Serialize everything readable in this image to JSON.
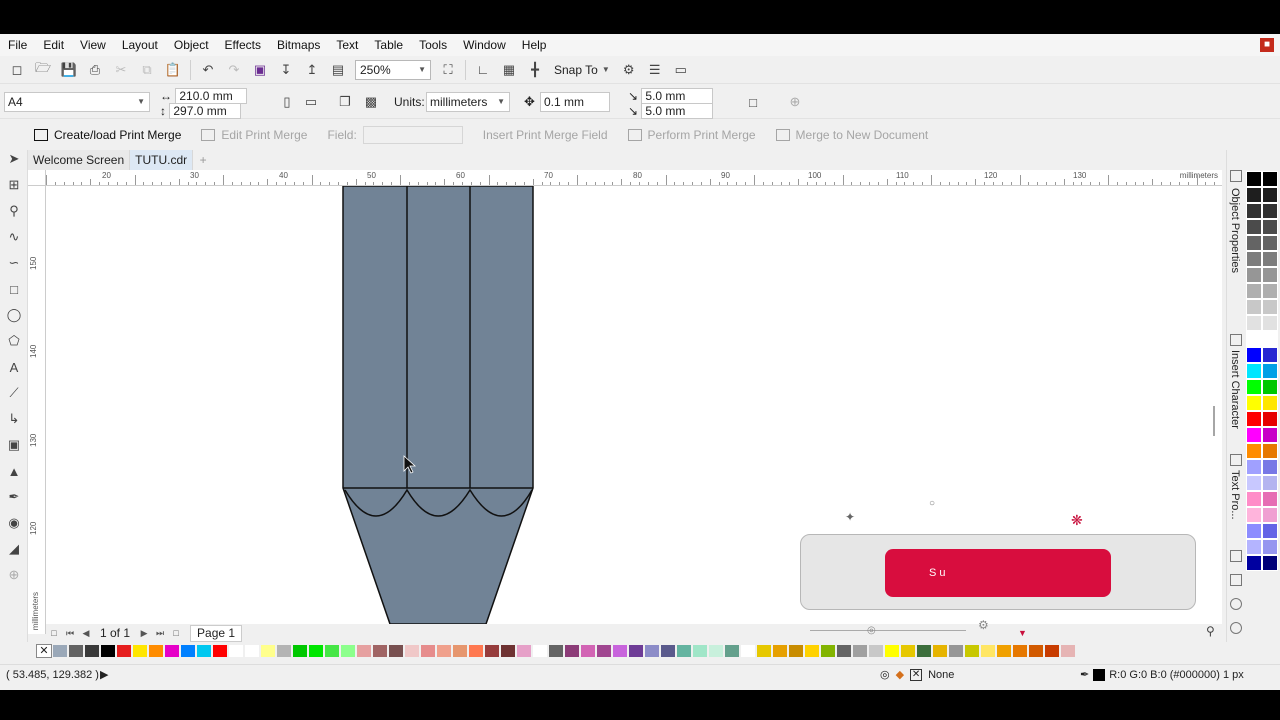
{
  "menu": {
    "items": [
      "File",
      "Edit",
      "View",
      "Layout",
      "Object",
      "Effects",
      "Bitmaps",
      "Text",
      "Table",
      "Tools",
      "Window",
      "Help"
    ]
  },
  "toolbar": {
    "zoom": "250%",
    "snap_to": "Snap To"
  },
  "property_bar": {
    "page_size": "A4",
    "width": "210.0 mm",
    "height": "297.0 mm",
    "units_label": "Units:",
    "units_value": "millimeters",
    "nudge": "0.1 mm",
    "dup_x": "5.0 mm",
    "dup_y": "5.0 mm"
  },
  "print_merge": {
    "create": "Create/load Print Merge",
    "edit": "Edit Print Merge",
    "field": "Field:",
    "insert": "Insert Print Merge Field",
    "perform": "Perform Print Merge",
    "merge_new": "Merge to New Document"
  },
  "tabs": [
    "Welcome Screen",
    "TUTU.cdr"
  ],
  "ruler": {
    "unit": "millimeters",
    "top_labels": [
      "20",
      "30",
      "40",
      "50",
      "60",
      "70",
      "80",
      "90",
      "100",
      "110",
      "120",
      "130"
    ],
    "left_labels": [
      "150",
      "140",
      "130",
      "120"
    ]
  },
  "pagenav": {
    "page_count": "1 of 1",
    "page_tab": "Page 1"
  },
  "dockers": [
    "Object Properties",
    "Insert Character",
    "Text Pro..."
  ],
  "status": {
    "coords": "( 53.485, 129.382 )",
    "fill_label": "None",
    "outline_info": "R:0 G:0 B:0 (#000000)  1 px"
  },
  "widget": {
    "button_text": "S  u"
  },
  "colors": {
    "pencil_fill": "#718396",
    "widget_button": "#d80d3e",
    "accent": "#c42b1c"
  },
  "palette_h": [
    "#9aa8b8",
    "#636363",
    "#3a3a3a",
    "#000000",
    "#e61e1e",
    "#ffe600",
    "#ff8c00",
    "#e600c8",
    "#0080ff",
    "#00c8f0",
    "#ff0000",
    "#ffffff",
    "#ffffff",
    "#ffff8c",
    "#b4b4b4",
    "#00c800",
    "#00e600",
    "#46e646",
    "#8cff8c",
    "#e6a0a0",
    "#a06464",
    "#785050",
    "#f0c8c8",
    "#e68c8c",
    "#f0a08c",
    "#e6966e",
    "#ff7850",
    "#963c3c",
    "#6e3232",
    "#e6a0c8",
    "#ffffff",
    "#646464",
    "#8c3c78",
    "#d264b4",
    "#a04690",
    "#c864dc",
    "#6e3c96",
    "#8c8cc8",
    "#5a5a8c",
    "#64b4a0",
    "#a0e6c8",
    "#c8f0dc",
    "#64a08c",
    "#ffffff",
    "#e6c800",
    "#e6a000",
    "#c88c00",
    "#ffd200",
    "#82b400",
    "#646464",
    "#a0a0a0",
    "#c8c8c8",
    "#ffff00",
    "#e6c800",
    "#3c6e3c",
    "#e6b400",
    "#969696",
    "#c8c800",
    "#ffe664",
    "#f0a000",
    "#e67800",
    "#d25a00",
    "#c83c00",
    "#e6b4b4"
  ],
  "palette_v": [
    "#000000",
    "#000000",
    "#1e1e1e",
    "#1e1e1e",
    "#323232",
    "#323232",
    "#4b4b4b",
    "#4b4b4b",
    "#646464",
    "#646464",
    "#7d7d7d",
    "#7d7d7d",
    "#969696",
    "#969696",
    "#afafaf",
    "#afafaf",
    "#c8c8c8",
    "#c8c8c8",
    "#e1e1e1",
    "#e1e1e1",
    "#ffffff",
    "#ffffff",
    "#0000ff",
    "#2828d2",
    "#00e6ff",
    "#00a0e6",
    "#00ff00",
    "#00c800",
    "#ffff00",
    "#ffe600",
    "#ff0000",
    "#e60000",
    "#ff00ff",
    "#c800c8",
    "#ff8c00",
    "#e67800",
    "#a0a0ff",
    "#7878e6",
    "#c8c8ff",
    "#b4b4f0",
    "#ff8cc8",
    "#e66eb4",
    "#ffb4dc",
    "#f0a0d2",
    "#8c8cff",
    "#6464e6",
    "#b4b4ff",
    "#9696f0",
    "#0000a0",
    "#000078"
  ]
}
